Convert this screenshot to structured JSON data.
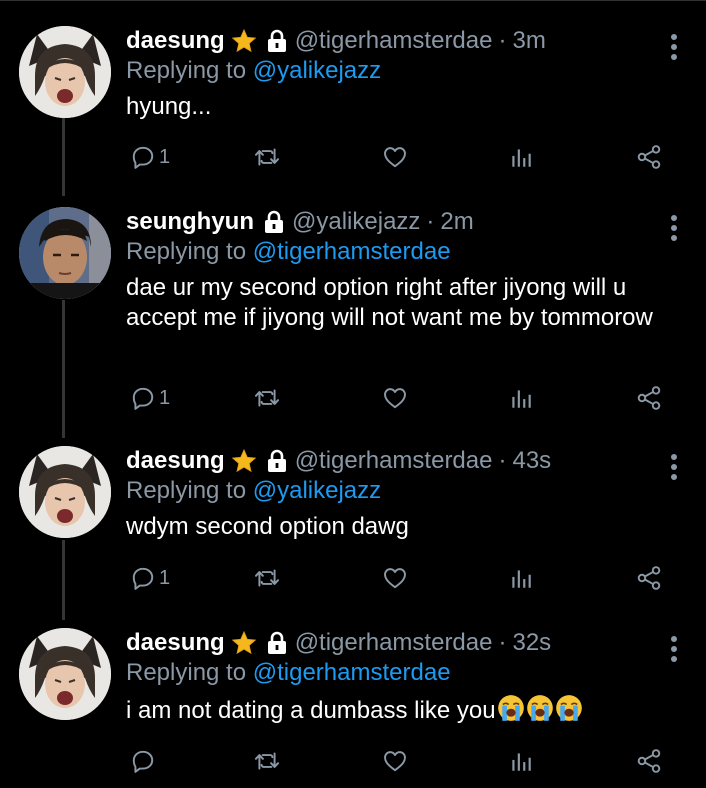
{
  "colors": {
    "background": "#000000",
    "secondary": "#8b98a5",
    "link": "#1d9bf0",
    "thread_line": "#333639"
  },
  "tweets": [
    {
      "name": "daesung",
      "badges": [
        "star",
        "lock"
      ],
      "handle": "@tigerhamsterdae",
      "time": "3m",
      "reply_prefix": "Replying to",
      "reply_to": "@yalikejazz",
      "text": "hyung...",
      "reply_count": "1",
      "avatar": "avatar-daesung"
    },
    {
      "name": "seunghyun",
      "badges": [
        "lock"
      ],
      "handle": "@yalikejazz",
      "time": "2m",
      "reply_prefix": "Replying to",
      "reply_to": "@tigerhamsterdae",
      "text": "dae ur my second option right after jiyong will u accept me if jiyong will not want me by tommorow",
      "reply_count": "1",
      "avatar": "avatar-seunghyun"
    },
    {
      "name": "daesung",
      "badges": [
        "star",
        "lock"
      ],
      "handle": "@tigerhamsterdae",
      "time": "43s",
      "reply_prefix": "Replying to",
      "reply_to": "@yalikejazz",
      "text": "wdym second option dawg",
      "reply_count": "1",
      "avatar": "avatar-daesung"
    },
    {
      "name": "daesung",
      "badges": [
        "star",
        "lock"
      ],
      "handle": "@tigerhamsterdae",
      "time": "32s",
      "reply_prefix": "Replying to",
      "reply_to": "@tigerhamsterdae",
      "text": "i am not dating a dumbass like you",
      "text_emojis": [
        "loudly-crying-face",
        "loudly-crying-face",
        "loudly-crying-face"
      ],
      "reply_count": "",
      "avatar": "avatar-daesung"
    }
  ]
}
